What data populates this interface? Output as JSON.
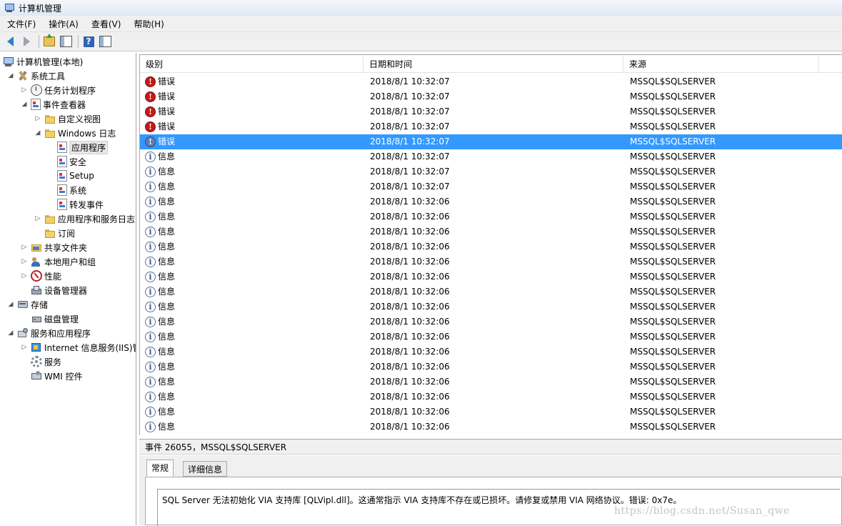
{
  "window": {
    "title": "计算机管理"
  },
  "menu": [
    "文件(F)",
    "操作(A)",
    "查看(V)",
    "帮助(H)"
  ],
  "tree": [
    {
      "label": "计算机管理(本地)",
      "icon": "computer-icon",
      "level": 0,
      "exp": ""
    },
    {
      "label": "系统工具",
      "icon": "tools-icon",
      "level": 1,
      "exp": "◢"
    },
    {
      "label": "任务计划程序",
      "icon": "clock-icon",
      "level": 2,
      "exp": "▷"
    },
    {
      "label": "事件查看器",
      "icon": "event-viewer-icon",
      "level": 2,
      "exp": "◢"
    },
    {
      "label": "自定义视图",
      "icon": "folder-icon",
      "level": 3,
      "exp": "▷"
    },
    {
      "label": "Windows 日志",
      "icon": "folder-icon",
      "level": 3,
      "exp": "◢"
    },
    {
      "label": "应用程序",
      "icon": "log-icon",
      "level": 4,
      "exp": "",
      "selected": true
    },
    {
      "label": "安全",
      "icon": "log-icon",
      "level": 4,
      "exp": ""
    },
    {
      "label": "Setup",
      "icon": "log-icon",
      "level": 4,
      "exp": ""
    },
    {
      "label": "系统",
      "icon": "log-icon",
      "level": 4,
      "exp": ""
    },
    {
      "label": "转发事件",
      "icon": "log-icon",
      "level": 4,
      "exp": ""
    },
    {
      "label": "应用程序和服务日志",
      "icon": "folder-icon",
      "level": 3,
      "exp": "▷"
    },
    {
      "label": "订阅",
      "icon": "folder-icon",
      "level": 3,
      "exp": ""
    },
    {
      "label": "共享文件夹",
      "icon": "shared-folder-icon",
      "level": 2,
      "exp": "▷"
    },
    {
      "label": "本地用户和组",
      "icon": "users-icon",
      "level": 2,
      "exp": "▷"
    },
    {
      "label": "性能",
      "icon": "performance-icon",
      "level": 2,
      "exp": "▷"
    },
    {
      "label": "设备管理器",
      "icon": "device-manager-icon",
      "level": 2,
      "exp": ""
    },
    {
      "label": "存储",
      "icon": "storage-icon",
      "level": 1,
      "exp": "◢"
    },
    {
      "label": "磁盘管理",
      "icon": "disk-icon",
      "level": 2,
      "exp": ""
    },
    {
      "label": "服务和应用程序",
      "icon": "services-apps-icon",
      "level": 1,
      "exp": "◢"
    },
    {
      "label": "Internet 信息服务(IIS)管",
      "icon": "iis-icon",
      "level": 2,
      "exp": "▷"
    },
    {
      "label": "服务",
      "icon": "gear-icon",
      "level": 2,
      "exp": ""
    },
    {
      "label": "WMI 控件",
      "icon": "wmi-icon",
      "level": 2,
      "exp": ""
    }
  ],
  "table": {
    "columns": [
      "级别",
      "日期和时间",
      "来源"
    ],
    "rows": [
      {
        "level": "错误",
        "type": "error",
        "datetime": "2018/8/1 10:32:07",
        "source": "MSSQL$SQLSERVER"
      },
      {
        "level": "错误",
        "type": "error",
        "datetime": "2018/8/1 10:32:07",
        "source": "MSSQL$SQLSERVER"
      },
      {
        "level": "错误",
        "type": "error",
        "datetime": "2018/8/1 10:32:07",
        "source": "MSSQL$SQLSERVER"
      },
      {
        "level": "错误",
        "type": "error",
        "datetime": "2018/8/1 10:32:07",
        "source": "MSSQL$SQLSERVER"
      },
      {
        "level": "错误",
        "type": "error",
        "datetime": "2018/8/1 10:32:07",
        "source": "MSSQL$SQLSERVER",
        "selected": true
      },
      {
        "level": "信息",
        "type": "info",
        "datetime": "2018/8/1 10:32:07",
        "source": "MSSQL$SQLSERVER"
      },
      {
        "level": "信息",
        "type": "info",
        "datetime": "2018/8/1 10:32:07",
        "source": "MSSQL$SQLSERVER"
      },
      {
        "level": "信息",
        "type": "info",
        "datetime": "2018/8/1 10:32:07",
        "source": "MSSQL$SQLSERVER"
      },
      {
        "level": "信息",
        "type": "info",
        "datetime": "2018/8/1 10:32:06",
        "source": "MSSQL$SQLSERVER"
      },
      {
        "level": "信息",
        "type": "info",
        "datetime": "2018/8/1 10:32:06",
        "source": "MSSQL$SQLSERVER"
      },
      {
        "level": "信息",
        "type": "info",
        "datetime": "2018/8/1 10:32:06",
        "source": "MSSQL$SQLSERVER"
      },
      {
        "level": "信息",
        "type": "info",
        "datetime": "2018/8/1 10:32:06",
        "source": "MSSQL$SQLSERVER"
      },
      {
        "level": "信息",
        "type": "info",
        "datetime": "2018/8/1 10:32:06",
        "source": "MSSQL$SQLSERVER"
      },
      {
        "level": "信息",
        "type": "info",
        "datetime": "2018/8/1 10:32:06",
        "source": "MSSQL$SQLSERVER"
      },
      {
        "level": "信息",
        "type": "info",
        "datetime": "2018/8/1 10:32:06",
        "source": "MSSQL$SQLSERVER"
      },
      {
        "level": "信息",
        "type": "info",
        "datetime": "2018/8/1 10:32:06",
        "source": "MSSQL$SQLSERVER"
      },
      {
        "level": "信息",
        "type": "info",
        "datetime": "2018/8/1 10:32:06",
        "source": "MSSQL$SQLSERVER"
      },
      {
        "level": "信息",
        "type": "info",
        "datetime": "2018/8/1 10:32:06",
        "source": "MSSQL$SQLSERVER"
      },
      {
        "level": "信息",
        "type": "info",
        "datetime": "2018/8/1 10:32:06",
        "source": "MSSQL$SQLSERVER"
      },
      {
        "level": "信息",
        "type": "info",
        "datetime": "2018/8/1 10:32:06",
        "source": "MSSQL$SQLSERVER"
      },
      {
        "level": "信息",
        "type": "info",
        "datetime": "2018/8/1 10:32:06",
        "source": "MSSQL$SQLSERVER"
      },
      {
        "level": "信息",
        "type": "info",
        "datetime": "2018/8/1 10:32:06",
        "source": "MSSQL$SQLSERVER"
      },
      {
        "level": "信息",
        "type": "info",
        "datetime": "2018/8/1 10:32:06",
        "source": "MSSQL$SQLSERVER"
      },
      {
        "level": "信息",
        "type": "info",
        "datetime": "2018/8/1 10:32:06",
        "source": "MSSQL$SQLSERVER"
      }
    ]
  },
  "detail": {
    "header": "事件 26055，MSSQL$SQLSERVER",
    "tabs": [
      "常规",
      "详细信息"
    ],
    "message": "SQL Server 无法初始化 VIA 支持库 [QLVipl.dll]。这通常指示 VIA 支持库不存在或已损坏。请修复或禁用 VIA 网络协议。错误: 0x7e。"
  },
  "watermark": "https://blog.csdn.net/Susan_qwe",
  "colors": {
    "selection": "#3399ff",
    "error": "#c81818",
    "chrome": "#f0f0f0"
  }
}
